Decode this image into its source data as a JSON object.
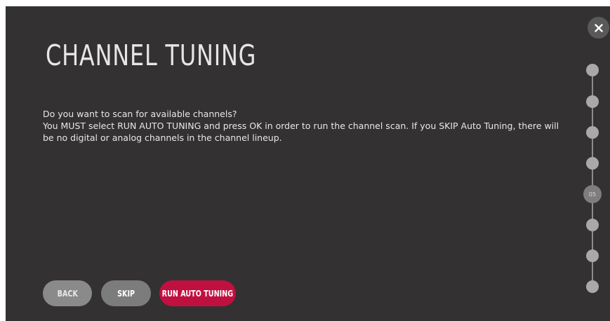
{
  "screen": {
    "title": "CHANNEL TUNING",
    "message_line1": "Do you want to scan for available channels?",
    "message_line2": "You MUST select RUN AUTO TUNING and press OK in order to run the channel scan. If you SKIP Auto Tuning, there will be no digital or analog channels in the channel lineup."
  },
  "buttons": {
    "back": "BACK",
    "skip": "SKIP",
    "run": "RUN AUTO TUNING"
  },
  "close_icon": "close-icon",
  "stepper": {
    "total_steps": 8,
    "current_step": 5,
    "current_label": "05"
  },
  "colors": {
    "background": "#333132",
    "accent": "#c0103f",
    "button_gray": "#8a8a8a"
  }
}
